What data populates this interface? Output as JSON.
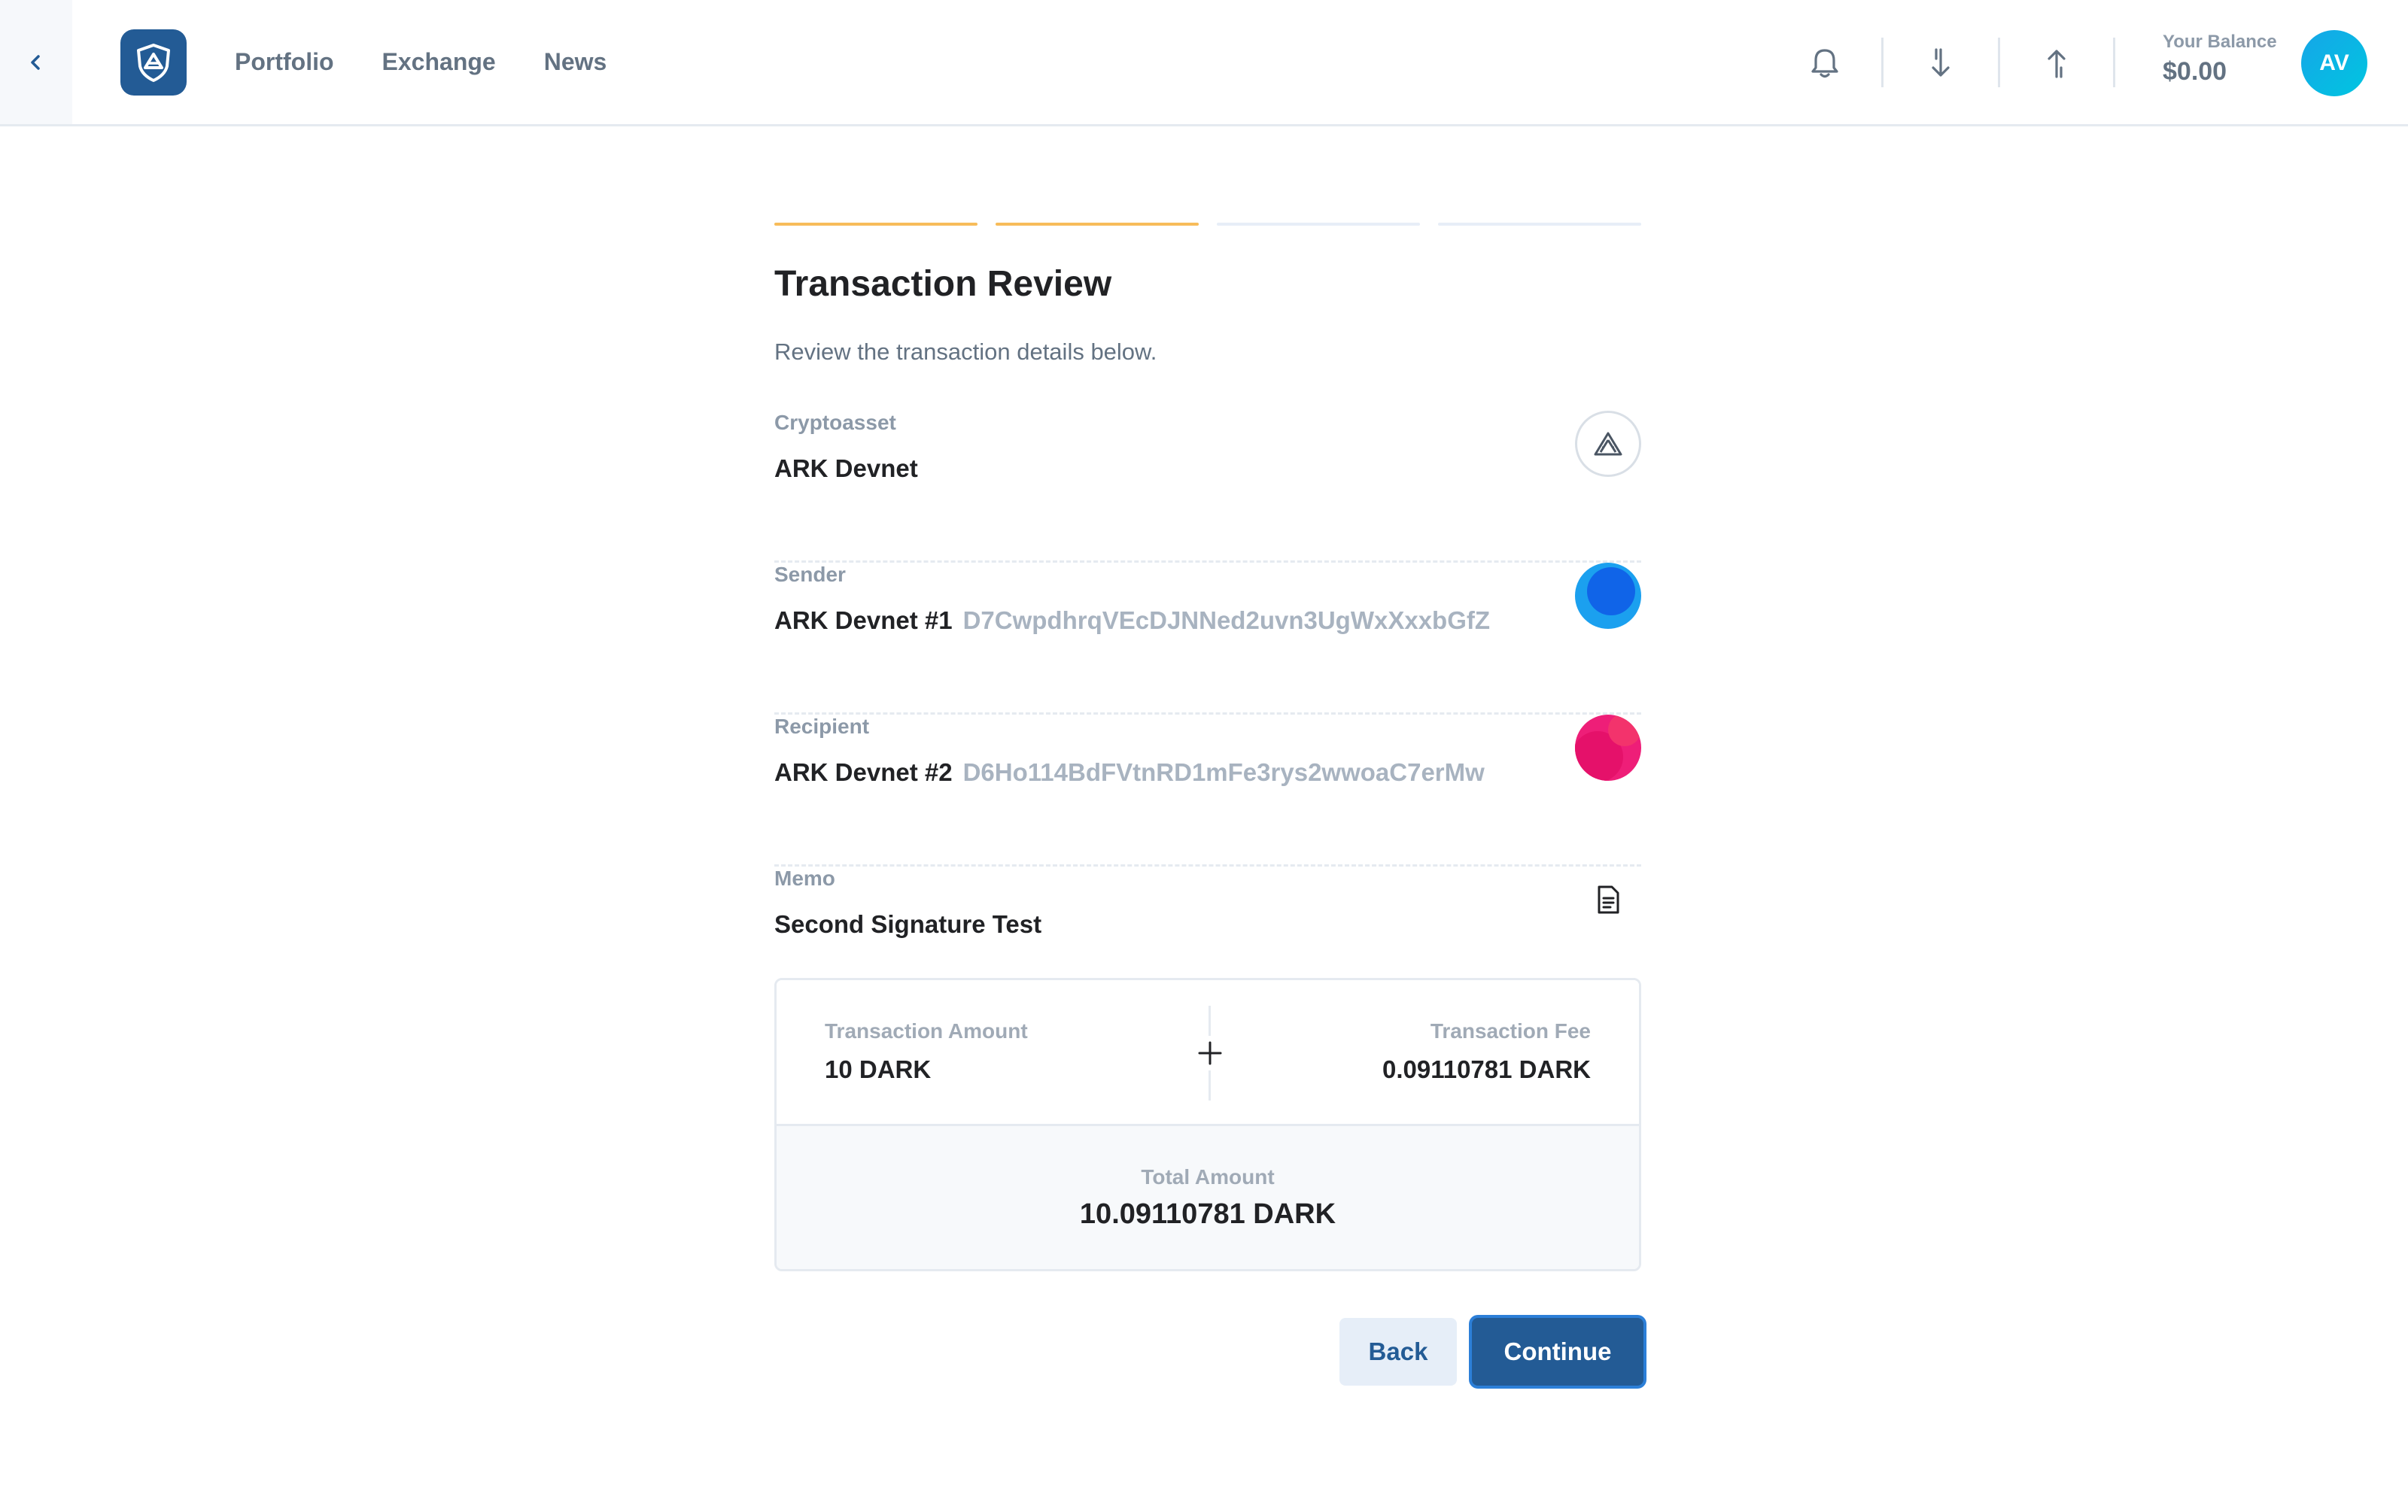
{
  "header": {
    "nav": [
      "Portfolio",
      "Exchange",
      "News"
    ],
    "balance_label": "Your Balance",
    "balance_value": "$0.00",
    "avatar_initials": "AV"
  },
  "steps": {
    "total": 4,
    "completed": 2
  },
  "review": {
    "title": "Transaction Review",
    "subtitle": "Review the transaction details below.",
    "cryptoasset": {
      "label": "Cryptoasset",
      "value": "ARK Devnet"
    },
    "sender": {
      "label": "Sender",
      "name": "ARK Devnet #1",
      "address": "D7CwpdhrqVEcDJNNed2uvn3UgWxXxxbGfZ"
    },
    "recipient": {
      "label": "Recipient",
      "name": "ARK Devnet #2",
      "address": "D6Ho114BdFVtnRD1mFe3rys2wwoaC7erMw"
    },
    "memo": {
      "label": "Memo",
      "value": "Second Signature Test"
    }
  },
  "summary": {
    "amount_label": "Transaction Amount",
    "amount_value": "10 DARK",
    "fee_label": "Transaction Fee",
    "fee_value": "0.09110781 DARK",
    "total_label": "Total Amount",
    "total_value": "10.09110781 DARK"
  },
  "buttons": {
    "back": "Back",
    "continue": "Continue"
  },
  "colors": {
    "accent": "#235b95",
    "step_done": "#f7bc5a",
    "sender_avatar": "#1ba0ef",
    "recipient_avatar": "#ee1e78"
  }
}
